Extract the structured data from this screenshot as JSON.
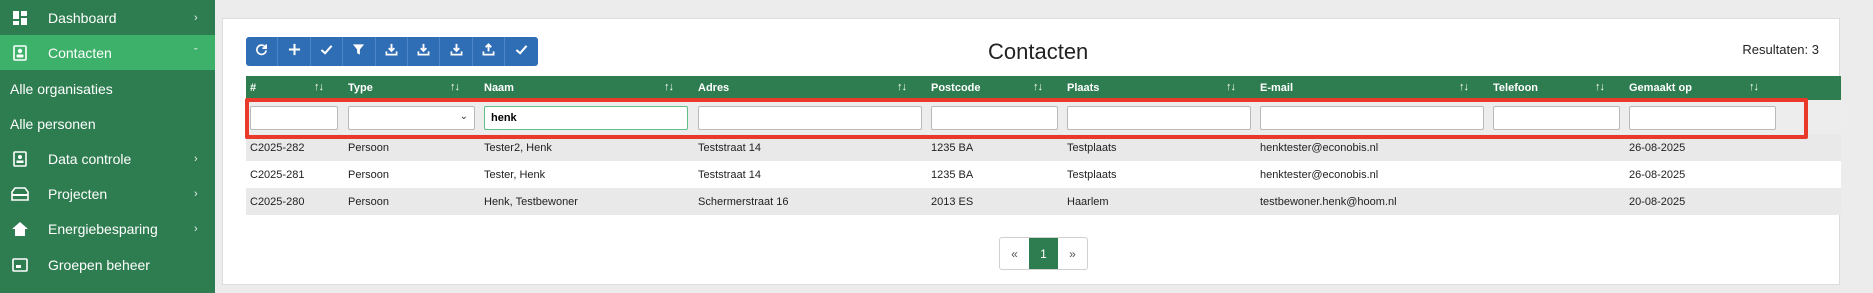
{
  "sidebar": {
    "items": [
      {
        "label": "Dashboard",
        "icon": "dashboard-icon"
      },
      {
        "label": "Contacten",
        "icon": "contacts-icon"
      },
      {
        "label": "Alle organisaties"
      },
      {
        "label": "Alle personen"
      },
      {
        "label": "Data controle",
        "icon": "data-control-icon"
      },
      {
        "label": "Projecten",
        "icon": "projects-icon"
      },
      {
        "label": "Energiebesparing",
        "icon": "home-icon"
      },
      {
        "label": "Groepen beheer",
        "icon": "groups-icon"
      }
    ]
  },
  "header": {
    "title": "Contacten",
    "results": "Resultaten: 3"
  },
  "toolbar": {
    "buttons": [
      "refresh-icon",
      "plus-icon",
      "check-icon",
      "filter-icon",
      "download-icon",
      "download-icon",
      "download-icon",
      "upload-icon",
      "check-icon"
    ]
  },
  "table": {
    "columns": [
      "#",
      "Type",
      "Naam",
      "Adres",
      "Postcode",
      "Plaats",
      "E-mail",
      "Telefoon",
      "Gemaakt op"
    ],
    "filters": {
      "number": "",
      "type": "",
      "naam": "henk",
      "adres": "",
      "postcode": "",
      "plaats": "",
      "email": "",
      "telefoon": "",
      "gemaakt_op": ""
    },
    "rows": [
      [
        "C2025-282",
        "Persoon",
        "Tester2, Henk",
        "Teststraat 14",
        "1235 BA",
        "Testplaats",
        "henktester@econobis.nl",
        "",
        "26-08-2025"
      ],
      [
        "C2025-281",
        "Persoon",
        "Tester, Henk",
        "Teststraat 14",
        "1235 BA",
        "Testplaats",
        "henktester@econobis.nl",
        "",
        "26-08-2025"
      ],
      [
        "C2025-280",
        "Persoon",
        "Henk, Testbewoner",
        "Schermerstraat 16",
        "2013 ES",
        "Haarlem",
        "testbewoner.henk@hoom.nl",
        "",
        "20-08-2025"
      ]
    ]
  },
  "pagination": {
    "prev": "«",
    "current": "1",
    "next": "»"
  },
  "colors": {
    "sidebar_bg": "#2e7d50",
    "sidebar_active": "#3db16a",
    "toolbar_bg": "#2f6db5",
    "table_header_bg": "#2e7d50",
    "highlight": "#e8392b"
  }
}
